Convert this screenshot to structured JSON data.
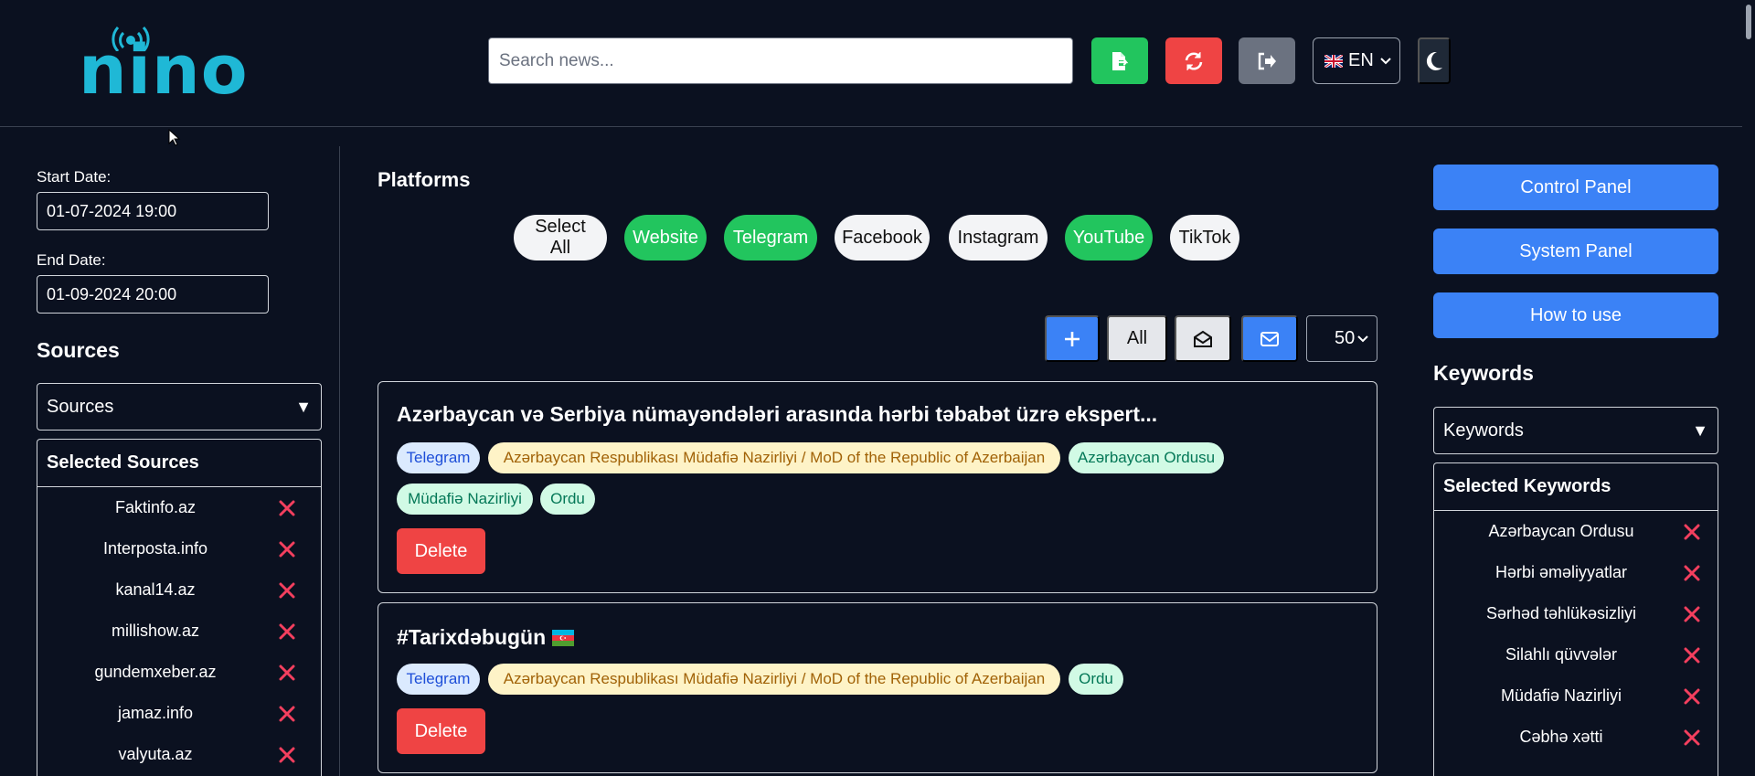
{
  "header": {
    "logo": "nino",
    "search_placeholder": "Search news...",
    "export_icon": "file-export-icon",
    "refresh_icon": "refresh-icon",
    "logout_icon": "sign-out-icon",
    "language": "EN",
    "theme_icon": "moon-icon"
  },
  "left": {
    "start_label": "Start Date:",
    "start_value": "01-07-2024 19:00",
    "end_label": "End Date:",
    "end_value": "01-09-2024 20:00",
    "sources_title": "Sources",
    "sources_select": "Sources",
    "selected_title": "Selected Sources",
    "selected": [
      "Faktinfo.az",
      "Interposta.info",
      "kanal14.az",
      "millishow.az",
      "gundemxeber.az",
      "jamaz.info",
      "valyuta.az"
    ]
  },
  "main": {
    "platforms_title": "Platforms",
    "platforms": [
      {
        "label": "Select All",
        "active": false
      },
      {
        "label": "Website",
        "active": true
      },
      {
        "label": "Telegram",
        "active": true
      },
      {
        "label": "Facebook",
        "active": false
      },
      {
        "label": "Instagram",
        "active": false
      },
      {
        "label": "YouTube",
        "active": true
      },
      {
        "label": "TikTok",
        "active": false
      }
    ],
    "filter_all": "All",
    "per_page": "50",
    "articles": [
      {
        "title": "Azərbaycan və Serbiya nümayəndələri arasında hərbi təbabət üzrə ekspert...",
        "tags": [
          "Telegram",
          "Azərbaycan Respublikası Müdafiə Nazirliyi / MoD of the Republic of Azerbaijan",
          "Azərbaycan Ordusu",
          "Müdafiə Nazirliyi",
          "Ordu"
        ],
        "delete": "Delete"
      },
      {
        "title": "#Tarixdəbugün",
        "tags": [
          "Telegram",
          "Azərbaycan Respublikası Müdafiə Nazirliyi / MoD of the Republic of Azerbaijan",
          "Ordu"
        ],
        "delete": "Delete"
      }
    ]
  },
  "right": {
    "control_panel": "Control Panel",
    "system_panel": "System Panel",
    "how_to_use": "How to use",
    "keywords_title": "Keywords",
    "keywords_select": "Keywords",
    "selected_title": "Selected Keywords",
    "selected": [
      "Azərbaycan Ordusu",
      "Hərbi əməliyyatlar",
      "Sərhəd təhlükəsizliyi",
      "Silahlı qüvvələr",
      "Müdafiə Nazirliyi",
      "Cəbhə xətti"
    ]
  },
  "colors": {
    "background": "#0b1120",
    "brand": "#1fb8d6",
    "green": "#22c55e",
    "red": "#ef4444",
    "blue": "#3b82f6"
  }
}
